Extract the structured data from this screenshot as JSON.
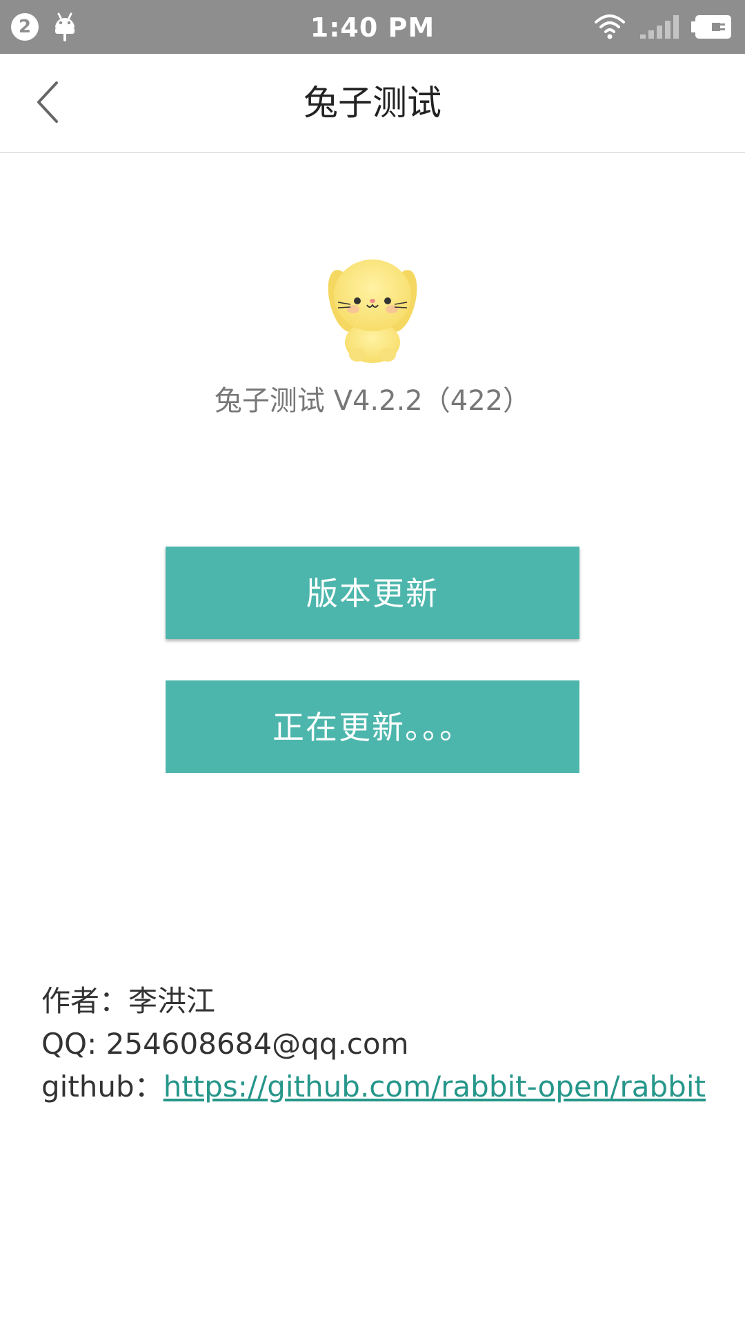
{
  "status_bar": {
    "notification_count": "2",
    "time": "1:40 PM",
    "icons": [
      "android-icon",
      "wifi-icon",
      "signal-icon",
      "battery-icon"
    ]
  },
  "toolbar": {
    "back_icon": "chevron-left-icon",
    "title": "兔子测试"
  },
  "app": {
    "logo": "rabbit-logo",
    "version_text": "兔子测试 V4.2.2（422）"
  },
  "buttons": {
    "update_label": "版本更新",
    "updating_label": "正在更新。。。"
  },
  "info": {
    "author_label": "作者：",
    "author_name": "李洪江",
    "qq_label": "QQ: ",
    "qq_value": "254608684@qq.com",
    "github_label": "github：",
    "github_url": "https://github.com/rabbit-open/rabbit"
  },
  "colors": {
    "status_bar": "#8e8e8e",
    "accent": "#4db6ac",
    "link": "#26968a"
  }
}
